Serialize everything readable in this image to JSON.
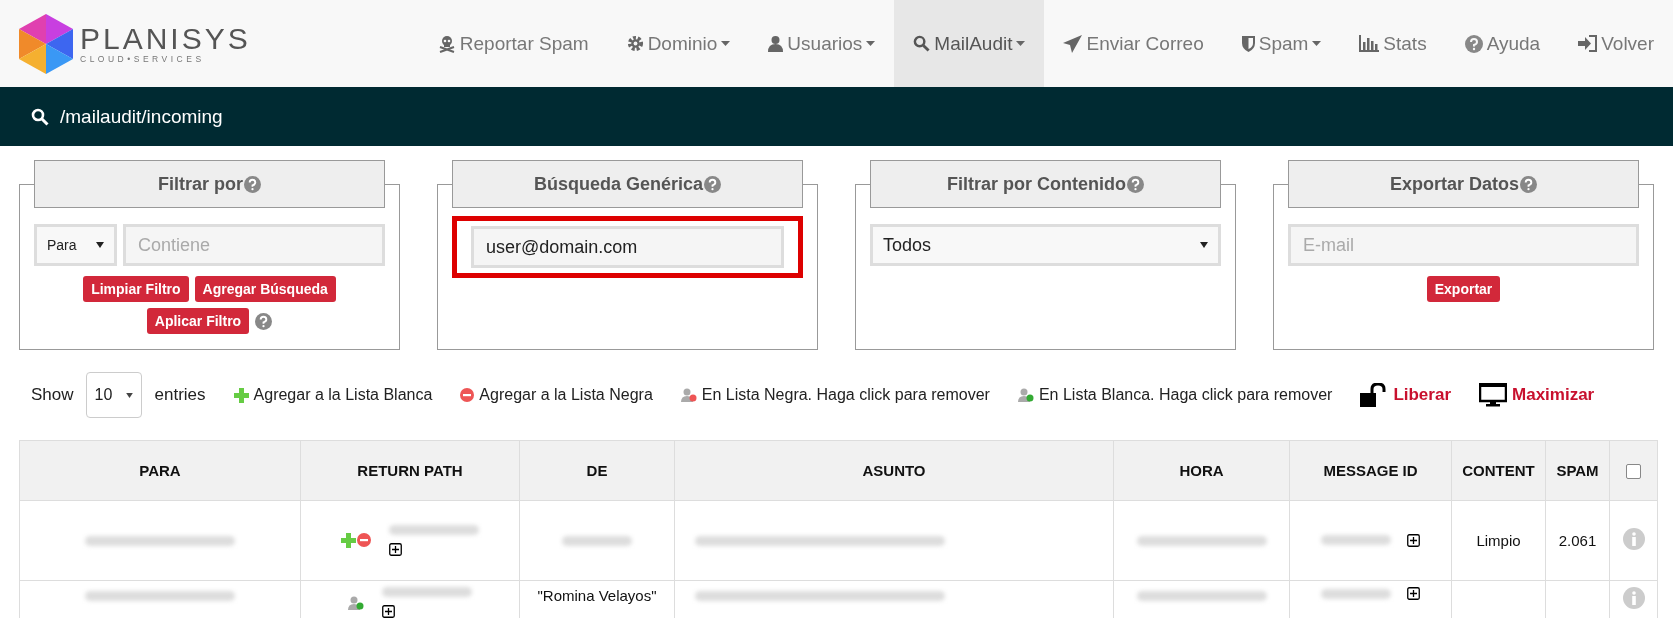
{
  "brand": {
    "name": "PLANISYS",
    "tagline": "CLOUD•SERVICES"
  },
  "nav": [
    {
      "label": "Reportar Spam",
      "kind": "skull",
      "dropdown": false,
      "selected": false
    },
    {
      "label": "Dominio",
      "kind": "gear",
      "dropdown": true,
      "selected": false
    },
    {
      "label": "Usuarios",
      "kind": "user",
      "dropdown": true,
      "selected": false
    },
    {
      "label": "MailAudit",
      "kind": "search",
      "dropdown": true,
      "selected": true
    },
    {
      "label": "Enviar Correo",
      "kind": "plane",
      "dropdown": false,
      "selected": false
    },
    {
      "label": "Spam",
      "kind": "shield",
      "dropdown": true,
      "selected": false
    },
    {
      "label": "Stats",
      "kind": "chart",
      "dropdown": false,
      "selected": false
    },
    {
      "label": "Ayuda",
      "kind": "help",
      "dropdown": false,
      "selected": false
    },
    {
      "label": "Volver",
      "kind": "signin",
      "dropdown": false,
      "selected": false
    }
  ],
  "path": "/mailaudit/incoming",
  "panels": [
    {
      "kind": "filter",
      "title": "Filtrar por",
      "select": "Para",
      "placeholder": "Contiene",
      "buttons": [
        "Limpiar Filtro",
        "Agregar Búsqueda",
        "Aplicar Filtro"
      ]
    },
    {
      "kind": "search",
      "title": "Búsqueda Genérica",
      "highlighted": true,
      "value": "user@domain.com"
    },
    {
      "kind": "dropdown",
      "title": "Filtrar por Contenido",
      "select": "Todos"
    },
    {
      "kind": "export",
      "title": "Exportar Datos",
      "placeholder": "E-mail",
      "buttons": [
        "Exportar"
      ]
    }
  ],
  "entries": {
    "show": "Show",
    "value": "10",
    "suffix": "entries"
  },
  "legend": [
    {
      "kind": "add-white",
      "label": "Agregar a la Lista Blanca"
    },
    {
      "kind": "add-black",
      "label": "Agregar a la Lista Negra"
    },
    {
      "kind": "in-black",
      "label": "En Lista Negra. Haga click para remover"
    },
    {
      "kind": "in-white",
      "label": "En Lista Blanca. Haga click para remover"
    },
    {
      "kind": "release",
      "label": "Liberar"
    },
    {
      "kind": "maximize",
      "label": "Maximizar"
    }
  ],
  "table": {
    "columns": [
      "PARA",
      "RETURN PATH",
      "DE",
      "ASUNTO",
      "HORA",
      "MESSAGE ID",
      "CONTENT",
      "SPAM"
    ],
    "select_all": false,
    "rows": [
      {
        "kind": "unlisted",
        "content": "Limpio",
        "spam": "2.061"
      },
      {
        "kind": "whitelisted",
        "de": "\"Romina Velayos\""
      }
    ]
  }
}
